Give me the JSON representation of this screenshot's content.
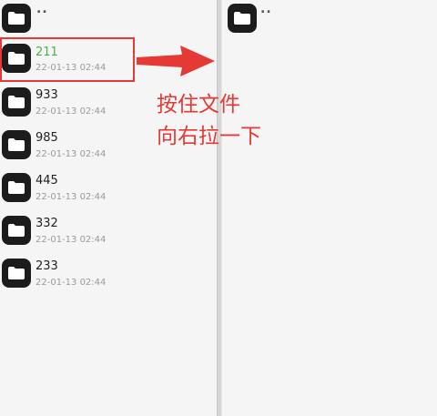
{
  "left_pane": {
    "parent_label": "..",
    "files": [
      {
        "name": "211",
        "date": "22-01-13 02:44",
        "selected": true
      },
      {
        "name": "933",
        "date": "22-01-13 02:44",
        "selected": false
      },
      {
        "name": "985",
        "date": "22-01-13 02:44",
        "selected": false
      },
      {
        "name": "445",
        "date": "22-01-13 02:44",
        "selected": false
      },
      {
        "name": "332",
        "date": "22-01-13 02:44",
        "selected": false
      },
      {
        "name": "233",
        "date": "22-01-13 02:44",
        "selected": false
      }
    ]
  },
  "right_pane": {
    "parent_label": ".."
  },
  "annotation": {
    "line1": "按住文件",
    "line2": "向右拉一下"
  },
  "colors": {
    "selected_name": "#4caf50",
    "annotation": "#e53935",
    "folder_icon": "#1c1c1c"
  }
}
